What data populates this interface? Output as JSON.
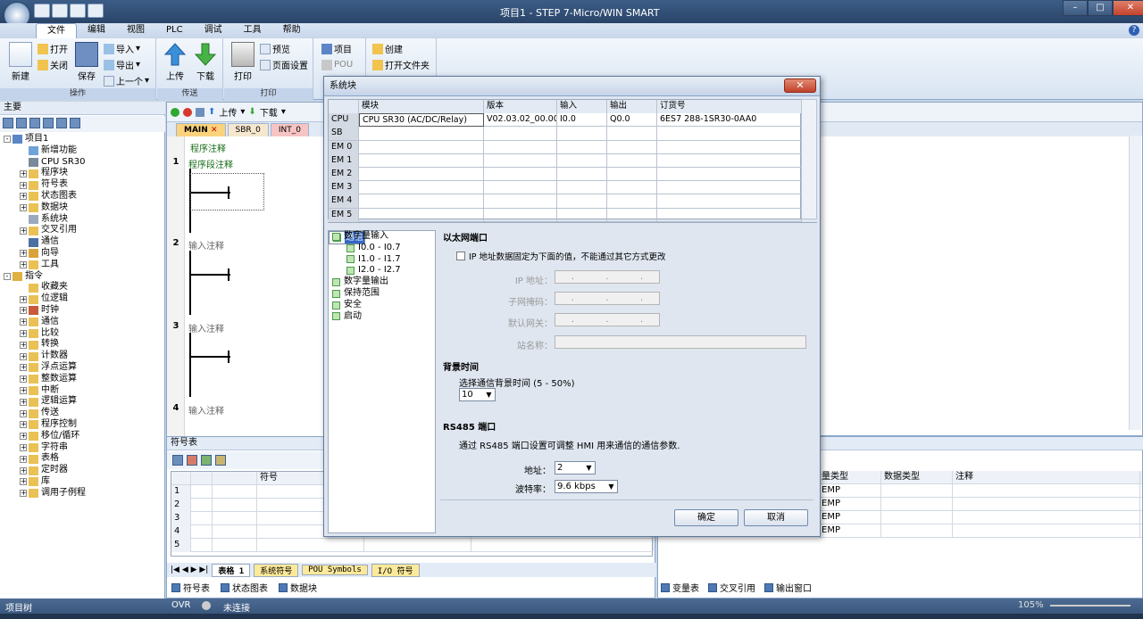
{
  "title": {
    "window_title": "项目1 - STEP 7-Micro/WIN SMART"
  },
  "ribbon": {
    "tabs": [
      "文件",
      "编辑",
      "视图",
      "PLC",
      "调试",
      "工具",
      "帮助"
    ],
    "active_tab": "文件",
    "groups": {
      "operation": {
        "label": "操作",
        "new": "新建",
        "open": "打开",
        "close": "关闭",
        "save": "保存",
        "import": "导入",
        "export": "导出",
        "previous": "上一个"
      },
      "transfer": {
        "label": "传送",
        "upload": "上传",
        "download": "下载"
      },
      "print": {
        "label": "打印",
        "print": "打印",
        "preview": "预览",
        "page_setup": "页面设置"
      },
      "project": {
        "project": "项目",
        "pou": "POU"
      },
      "create": {
        "create": "创建",
        "open_folder": "打开文件夹"
      }
    }
  },
  "left_panel": {
    "header": "主要",
    "tree": [
      {
        "label": "项目1",
        "level": 0,
        "exp": "-",
        "icon": "project-icon"
      },
      {
        "label": "新增功能",
        "level": 1,
        "exp": "",
        "icon": "help-icon"
      },
      {
        "label": "CPU SR30",
        "level": 1,
        "exp": "",
        "icon": "cpu-icon"
      },
      {
        "label": "程序块",
        "level": 1,
        "exp": "+",
        "icon": "folder-icon"
      },
      {
        "label": "符号表",
        "level": 1,
        "exp": "+",
        "icon": "folder-icon"
      },
      {
        "label": "状态图表",
        "level": 1,
        "exp": "+",
        "icon": "folder-icon"
      },
      {
        "label": "数据块",
        "level": 1,
        "exp": "+",
        "icon": "folder-icon"
      },
      {
        "label": "系统块",
        "level": 1,
        "exp": "",
        "icon": "system-block-icon"
      },
      {
        "label": "交叉引用",
        "level": 1,
        "exp": "+",
        "icon": "folder-icon"
      },
      {
        "label": "通信",
        "level": 1,
        "exp": "",
        "icon": "communication-icon"
      },
      {
        "label": "向导",
        "level": 1,
        "exp": "+",
        "icon": "wizard-icon"
      },
      {
        "label": "工具",
        "level": 1,
        "exp": "+",
        "icon": "folder-icon"
      },
      {
        "label": "指令",
        "level": 0,
        "exp": "-",
        "icon": "instructions-icon"
      },
      {
        "label": "收藏夹",
        "level": 1,
        "exp": "",
        "icon": "folder-icon"
      },
      {
        "label": "位逻辑",
        "level": 1,
        "exp": "+",
        "icon": "folder-icon"
      },
      {
        "label": "时钟",
        "level": 1,
        "exp": "+",
        "icon": "clock-icon"
      },
      {
        "label": "通信",
        "level": 1,
        "exp": "+",
        "icon": "folder-icon"
      },
      {
        "label": "比较",
        "level": 1,
        "exp": "+",
        "icon": "folder-icon"
      },
      {
        "label": "转换",
        "level": 1,
        "exp": "+",
        "icon": "folder-icon"
      },
      {
        "label": "计数器",
        "level": 1,
        "exp": "+",
        "icon": "folder-icon"
      },
      {
        "label": "浮点运算",
        "level": 1,
        "exp": "+",
        "icon": "folder-icon"
      },
      {
        "label": "整数运算",
        "level": 1,
        "exp": "+",
        "icon": "folder-icon"
      },
      {
        "label": "中断",
        "level": 1,
        "exp": "+",
        "icon": "folder-icon"
      },
      {
        "label": "逻辑运算",
        "level": 1,
        "exp": "+",
        "icon": "folder-icon"
      },
      {
        "label": "传送",
        "level": 1,
        "exp": "+",
        "icon": "folder-icon"
      },
      {
        "label": "程序控制",
        "level": 1,
        "exp": "+",
        "icon": "folder-icon"
      },
      {
        "label": "移位/循环",
        "level": 1,
        "exp": "+",
        "icon": "folder-icon"
      },
      {
        "label": "字符串",
        "level": 1,
        "exp": "+",
        "icon": "folder-icon"
      },
      {
        "label": "表格",
        "level": 1,
        "exp": "+",
        "icon": "folder-icon"
      },
      {
        "label": "定时器",
        "level": 1,
        "exp": "+",
        "icon": "folder-icon"
      },
      {
        "label": "库",
        "level": 1,
        "exp": "+",
        "icon": "folder-icon"
      },
      {
        "label": "调用子例程",
        "level": 1,
        "exp": "+",
        "icon": "folder-icon"
      }
    ]
  },
  "editor": {
    "toolbar": {
      "upload": "上传",
      "download": "下载"
    },
    "tabs": [
      "MAIN",
      "SBR_0",
      "INT_0"
    ],
    "program_comment": "程序注释",
    "rungs": [
      {
        "num": "1",
        "comment": "程序段注释"
      },
      {
        "num": "2",
        "comment": "输入注释"
      },
      {
        "num": "3",
        "comment": "输入注释"
      },
      {
        "num": "4",
        "comment": "输入注释"
      }
    ]
  },
  "symbol_table": {
    "header": "符号表",
    "col_symbol": "符号",
    "rows": [
      "1",
      "2",
      "3",
      "4",
      "5"
    ],
    "sheet_tabs": [
      "表格 1",
      "系统符号",
      "POU Symbols",
      "I/O 符号"
    ],
    "bottom_tabs": [
      "符号表",
      "状态图表",
      "数据块"
    ]
  },
  "var_table": {
    "columns": [
      "量类型",
      "数据类型",
      "注释"
    ],
    "rows": [
      "EMP",
      "EMP",
      "EMP",
      "EMP"
    ],
    "bottom_tabs": [
      "变量表",
      "交叉引用",
      "输出窗口"
    ]
  },
  "status_bar": {
    "left": "项目树",
    "ovr": "OVR",
    "conn": "未连接",
    "zoom": "105%"
  },
  "dialog": {
    "title": "系统块",
    "close": "✕",
    "table_headers": [
      "",
      "模块",
      "版本",
      "输入",
      "输出",
      "订货号"
    ],
    "rows": [
      [
        "CPU",
        "CPU SR30 (AC/DC/Relay)",
        "V02.03.02_00.00...",
        "I0.0",
        "Q0.0",
        "6ES7 288-1SR30-0AA0"
      ],
      [
        "SB",
        "",
        "",
        "",
        "",
        ""
      ],
      [
        "EM 0",
        "",
        "",
        "",
        "",
        ""
      ],
      [
        "EM 1",
        "",
        "",
        "",
        "",
        ""
      ],
      [
        "EM 2",
        "",
        "",
        "",
        "",
        ""
      ],
      [
        "EM 3",
        "",
        "",
        "",
        "",
        ""
      ],
      [
        "EM 4",
        "",
        "",
        "",
        "",
        ""
      ],
      [
        "EM 5",
        "",
        "",
        "",
        "",
        ""
      ]
    ],
    "tree": [
      {
        "label": "通信",
        "level": 0,
        "selected": true
      },
      {
        "label": "数字量输入",
        "level": 0,
        "selected": false
      },
      {
        "label": "I0.0 - I0.7",
        "level": 1,
        "selected": false
      },
      {
        "label": "I1.0 - I1.7",
        "level": 1,
        "selected": false
      },
      {
        "label": "I2.0 - I2.7",
        "level": 1,
        "selected": false
      },
      {
        "label": "数字量输出",
        "level": 0,
        "selected": false
      },
      {
        "label": "保持范围",
        "level": 0,
        "selected": false
      },
      {
        "label": "安全",
        "level": 0,
        "selected": false
      },
      {
        "label": "启动",
        "level": 0,
        "selected": false
      }
    ],
    "ethernet": {
      "title": "以太网端口",
      "fixed_ip_label": "IP 地址数据固定为下面的值，不能通过其它方式更改",
      "ip_label": "IP 地址：",
      "subnet_label": "子网掩码：",
      "gateway_label": "默认网关：",
      "station_label": "站名称："
    },
    "background": {
      "title": "背景时间",
      "label": "选择通信背景时间 (5 - 50%)",
      "value": "10"
    },
    "rs485": {
      "title": "RS485 端口",
      "desc": "通过 RS485 端口设置可调整 HMI 用来通信的通信参数.",
      "address_label": "地址：",
      "address_value": "2",
      "baud_label": "波特率：",
      "baud_value": "9.6 kbps"
    },
    "ok": "确定",
    "cancel": "取消"
  }
}
